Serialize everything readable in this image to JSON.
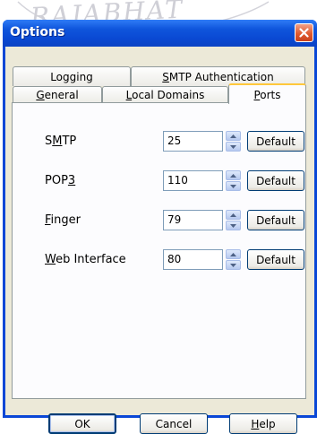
{
  "watermark": {
    "text": "RAJABHAT"
  },
  "window": {
    "title": "Options"
  },
  "tabs": {
    "row_back": [
      {
        "pre": "",
        "key": "",
        "post": "Logging"
      },
      {
        "pre": "",
        "key": "S",
        "post": "MTP Authentication"
      }
    ],
    "row_front": [
      {
        "pre": "",
        "key": "G",
        "post": "eneral"
      },
      {
        "pre": "",
        "key": "L",
        "post": "ocal Domains"
      },
      {
        "pre": "",
        "key": "P",
        "post": "orts"
      }
    ]
  },
  "ports": [
    {
      "label_pre": "S",
      "label_key": "M",
      "label_post": "TP",
      "value": "25",
      "default_label": "Default"
    },
    {
      "label_pre": "POP",
      "label_key": "3",
      "label_post": "",
      "value": "110",
      "default_label": "Default"
    },
    {
      "label_pre": "",
      "label_key": "F",
      "label_post": "inger",
      "value": "79",
      "default_label": "Default"
    },
    {
      "label_pre": "",
      "label_key": "W",
      "label_post": "eb Interface",
      "value": "80",
      "default_label": "Default"
    }
  ],
  "buttons": {
    "ok": "OK",
    "cancel": "Cancel",
    "help_key": "H",
    "help_rest": "elp"
  },
  "colors": {
    "titlebar": "#0a49d3",
    "close": "#e05a2f",
    "active_tab_highlight": "#ffc83c",
    "dialog_face": "#ece9d8"
  }
}
